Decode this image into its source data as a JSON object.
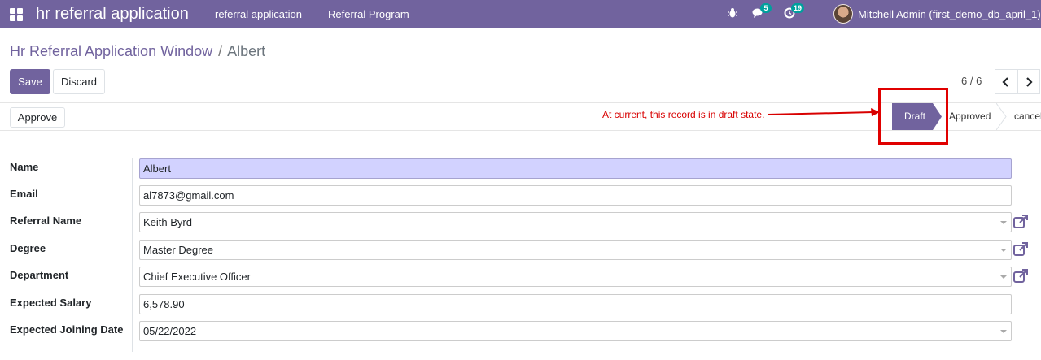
{
  "navbar": {
    "app_title": "hr referral application",
    "menus": [
      "referral application",
      "Referral Program"
    ],
    "messages_badge": "5",
    "activities_badge": "19",
    "user_name": "Mitchell Admin (first_demo_db_april_1)",
    "color": "#71639e"
  },
  "breadcrumb": {
    "parent": "Hr Referral Application Window",
    "separator": "/",
    "current": "Albert"
  },
  "toolbar": {
    "save_label": "Save",
    "discard_label": "Discard",
    "pager_value": "6 / 6"
  },
  "statusbar": {
    "approve_label": "Approve",
    "annotation": "At current, this record is in draft state.",
    "stages": [
      "Draft",
      "Approved",
      "cancel"
    ],
    "current_stage": "Draft",
    "annotation_color": "#d80000"
  },
  "form": {
    "fields": [
      {
        "label": "Name",
        "value": "Albert",
        "type": "text"
      },
      {
        "label": "Email",
        "value": "al7873@gmail.com",
        "type": "text"
      },
      {
        "label": "Referral Name",
        "value": "Keith Byrd",
        "type": "many2one"
      },
      {
        "label": "Degree",
        "value": "Master Degree",
        "type": "many2one"
      },
      {
        "label": "Department",
        "value": "Chief Executive Officer",
        "type": "many2one"
      },
      {
        "label": "Expected Salary",
        "value": "6,578.90",
        "type": "text"
      },
      {
        "label": "Expected Joining Date",
        "value": "05/22/2022",
        "type": "date"
      }
    ]
  }
}
